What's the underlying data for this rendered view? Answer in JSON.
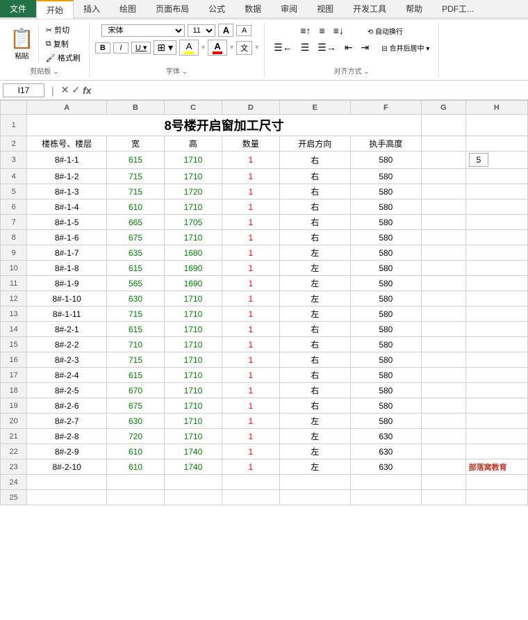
{
  "ribbon": {
    "tabs": [
      "文件",
      "开始",
      "插入",
      "绘图",
      "页面布局",
      "公式",
      "数据",
      "审阅",
      "视图",
      "开发工具",
      "帮助",
      "PDF工..."
    ],
    "active_tab": "开始",
    "groups": {
      "clipboard": {
        "label": "剪贴板",
        "paste": "粘贴",
        "cut": "剪切",
        "copy": "复制",
        "format_painter": "格式刷"
      },
      "font": {
        "label": "字体",
        "font_name": "宋体",
        "font_size": "11",
        "bold": "B",
        "italic": "I",
        "underline": "U",
        "border": "⊞",
        "fill": "填充颜色",
        "font_color": "字体颜色",
        "increase_font": "A",
        "decrease_font": "A",
        "phonetic": "文"
      },
      "alignment": {
        "label": "对齐方式",
        "auto_wrap": "自动换行",
        "merge": "合并后居中",
        "align_top": "↑",
        "align_middle": "≡",
        "align_bottom": "↓",
        "align_left": "←",
        "align_center": "≡",
        "align_right": "→",
        "decrease_indent": "←",
        "increase_indent": "→",
        "orientation": "ab"
      }
    }
  },
  "formula_bar": {
    "cell_ref": "I17",
    "cancel_label": "✕",
    "confirm_label": "✓",
    "function_label": "fx",
    "formula_value": ""
  },
  "column_headers": [
    "",
    "A",
    "B",
    "C",
    "D",
    "E",
    "F",
    "G",
    "H"
  ],
  "spreadsheet": {
    "title": "8号楼开启窗加工尺寸",
    "headers": [
      "楼栋号、楼层",
      "宽",
      "高",
      "数量",
      "开启方向",
      "执手高度"
    ],
    "rows": [
      {
        "num": 3,
        "name": "8#-1-1",
        "width": "615",
        "height": "1710",
        "qty": "1",
        "dir": "右",
        "handle": "580"
      },
      {
        "num": 4,
        "name": "8#-1-2",
        "width": "715",
        "height": "1710",
        "qty": "1",
        "dir": "右",
        "handle": "580"
      },
      {
        "num": 5,
        "name": "8#-1-3",
        "width": "715",
        "height": "1720",
        "qty": "1",
        "dir": "右",
        "handle": "580"
      },
      {
        "num": 6,
        "name": "8#-1-4",
        "width": "610",
        "height": "1710",
        "qty": "1",
        "dir": "右",
        "handle": "580"
      },
      {
        "num": 7,
        "name": "8#-1-5",
        "width": "665",
        "height": "1705",
        "qty": "1",
        "dir": "右",
        "handle": "580"
      },
      {
        "num": 8,
        "name": "8#-1-6",
        "width": "675",
        "height": "1710",
        "qty": "1",
        "dir": "右",
        "handle": "580"
      },
      {
        "num": 9,
        "name": "8#-1-7",
        "width": "635",
        "height": "1680",
        "qty": "1",
        "dir": "左",
        "handle": "580"
      },
      {
        "num": 10,
        "name": "8#-1-8",
        "width": "615",
        "height": "1690",
        "qty": "1",
        "dir": "左",
        "handle": "580"
      },
      {
        "num": 11,
        "name": "8#-1-9",
        "width": "565",
        "height": "1690",
        "qty": "1",
        "dir": "左",
        "handle": "580"
      },
      {
        "num": 12,
        "name": "8#-1-10",
        "width": "630",
        "height": "1710",
        "qty": "1",
        "dir": "左",
        "handle": "580"
      },
      {
        "num": 13,
        "name": "8#-1-11",
        "width": "715",
        "height": "1710",
        "qty": "1",
        "dir": "左",
        "handle": "580"
      },
      {
        "num": 14,
        "name": "8#-2-1",
        "width": "615",
        "height": "1710",
        "qty": "1",
        "dir": "右",
        "handle": "580"
      },
      {
        "num": 15,
        "name": "8#-2-2",
        "width": "710",
        "height": "1710",
        "qty": "1",
        "dir": "右",
        "handle": "580"
      },
      {
        "num": 16,
        "name": "8#-2-3",
        "width": "715",
        "height": "1710",
        "qty": "1",
        "dir": "右",
        "handle": "580"
      },
      {
        "num": 17,
        "name": "8#-2-4",
        "width": "615",
        "height": "1710",
        "qty": "1",
        "dir": "右",
        "handle": "580"
      },
      {
        "num": 18,
        "name": "8#-2-5",
        "width": "670",
        "height": "1710",
        "qty": "1",
        "dir": "右",
        "handle": "580"
      },
      {
        "num": 19,
        "name": "8#-2-6",
        "width": "675",
        "height": "1710",
        "qty": "1",
        "dir": "右",
        "handle": "580"
      },
      {
        "num": 20,
        "name": "8#-2-7",
        "width": "630",
        "height": "1710",
        "qty": "1",
        "dir": "左",
        "handle": "580"
      },
      {
        "num": 21,
        "name": "8#-2-8",
        "width": "720",
        "height": "1710",
        "qty": "1",
        "dir": "左",
        "handle": "630"
      },
      {
        "num": 22,
        "name": "8#-2-9",
        "width": "610",
        "height": "1740",
        "qty": "1",
        "dir": "左",
        "handle": "630"
      },
      {
        "num": 23,
        "name": "8#-2-10",
        "width": "610",
        "height": "1740",
        "qty": "1",
        "dir": "左",
        "handle": "630"
      }
    ],
    "extra_cell_h1": "5",
    "watermark": "部落窝教育"
  }
}
